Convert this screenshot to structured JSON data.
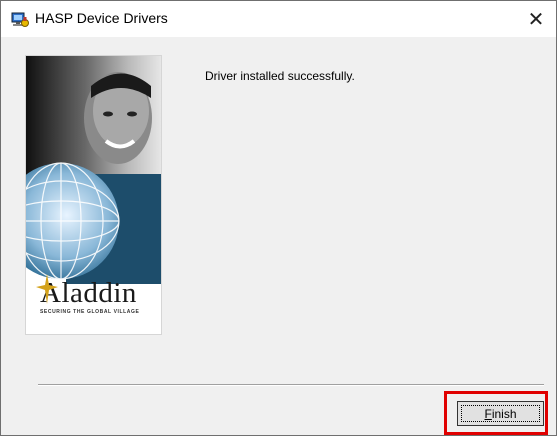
{
  "window": {
    "title": "HASP Device Drivers",
    "close_glyph": "✕",
    "app_icon": "hasp-driver-icon"
  },
  "banner": {
    "brand": "Aladdin",
    "tagline": "SECURING THE GLOBAL VILLAGE",
    "brand_color": "#1f4f6f"
  },
  "main": {
    "message": "Driver installed successfully."
  },
  "footer": {
    "finish_label": "Finish",
    "finish_mnemonic": "F"
  },
  "colors": {
    "highlight": "#e00000",
    "window_bg": "#f0f0f0"
  }
}
